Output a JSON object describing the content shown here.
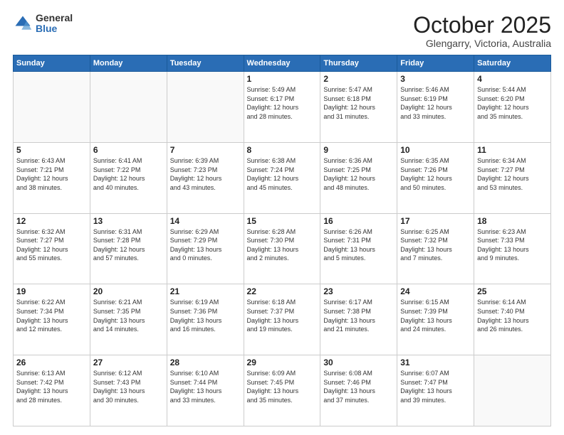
{
  "logo": {
    "general": "General",
    "blue": "Blue"
  },
  "title": "October 2025",
  "location": "Glengarry, Victoria, Australia",
  "days_header": [
    "Sunday",
    "Monday",
    "Tuesday",
    "Wednesday",
    "Thursday",
    "Friday",
    "Saturday"
  ],
  "weeks": [
    [
      {
        "day": "",
        "info": ""
      },
      {
        "day": "",
        "info": ""
      },
      {
        "day": "",
        "info": ""
      },
      {
        "day": "1",
        "info": "Sunrise: 5:49 AM\nSunset: 6:17 PM\nDaylight: 12 hours\nand 28 minutes."
      },
      {
        "day": "2",
        "info": "Sunrise: 5:47 AM\nSunset: 6:18 PM\nDaylight: 12 hours\nand 31 minutes."
      },
      {
        "day": "3",
        "info": "Sunrise: 5:46 AM\nSunset: 6:19 PM\nDaylight: 12 hours\nand 33 minutes."
      },
      {
        "day": "4",
        "info": "Sunrise: 5:44 AM\nSunset: 6:20 PM\nDaylight: 12 hours\nand 35 minutes."
      }
    ],
    [
      {
        "day": "5",
        "info": "Sunrise: 6:43 AM\nSunset: 7:21 PM\nDaylight: 12 hours\nand 38 minutes."
      },
      {
        "day": "6",
        "info": "Sunrise: 6:41 AM\nSunset: 7:22 PM\nDaylight: 12 hours\nand 40 minutes."
      },
      {
        "day": "7",
        "info": "Sunrise: 6:39 AM\nSunset: 7:23 PM\nDaylight: 12 hours\nand 43 minutes."
      },
      {
        "day": "8",
        "info": "Sunrise: 6:38 AM\nSunset: 7:24 PM\nDaylight: 12 hours\nand 45 minutes."
      },
      {
        "day": "9",
        "info": "Sunrise: 6:36 AM\nSunset: 7:25 PM\nDaylight: 12 hours\nand 48 minutes."
      },
      {
        "day": "10",
        "info": "Sunrise: 6:35 AM\nSunset: 7:26 PM\nDaylight: 12 hours\nand 50 minutes."
      },
      {
        "day": "11",
        "info": "Sunrise: 6:34 AM\nSunset: 7:27 PM\nDaylight: 12 hours\nand 53 minutes."
      }
    ],
    [
      {
        "day": "12",
        "info": "Sunrise: 6:32 AM\nSunset: 7:27 PM\nDaylight: 12 hours\nand 55 minutes."
      },
      {
        "day": "13",
        "info": "Sunrise: 6:31 AM\nSunset: 7:28 PM\nDaylight: 12 hours\nand 57 minutes."
      },
      {
        "day": "14",
        "info": "Sunrise: 6:29 AM\nSunset: 7:29 PM\nDaylight: 13 hours\nand 0 minutes."
      },
      {
        "day": "15",
        "info": "Sunrise: 6:28 AM\nSunset: 7:30 PM\nDaylight: 13 hours\nand 2 minutes."
      },
      {
        "day": "16",
        "info": "Sunrise: 6:26 AM\nSunset: 7:31 PM\nDaylight: 13 hours\nand 5 minutes."
      },
      {
        "day": "17",
        "info": "Sunrise: 6:25 AM\nSunset: 7:32 PM\nDaylight: 13 hours\nand 7 minutes."
      },
      {
        "day": "18",
        "info": "Sunrise: 6:23 AM\nSunset: 7:33 PM\nDaylight: 13 hours\nand 9 minutes."
      }
    ],
    [
      {
        "day": "19",
        "info": "Sunrise: 6:22 AM\nSunset: 7:34 PM\nDaylight: 13 hours\nand 12 minutes."
      },
      {
        "day": "20",
        "info": "Sunrise: 6:21 AM\nSunset: 7:35 PM\nDaylight: 13 hours\nand 14 minutes."
      },
      {
        "day": "21",
        "info": "Sunrise: 6:19 AM\nSunset: 7:36 PM\nDaylight: 13 hours\nand 16 minutes."
      },
      {
        "day": "22",
        "info": "Sunrise: 6:18 AM\nSunset: 7:37 PM\nDaylight: 13 hours\nand 19 minutes."
      },
      {
        "day": "23",
        "info": "Sunrise: 6:17 AM\nSunset: 7:38 PM\nDaylight: 13 hours\nand 21 minutes."
      },
      {
        "day": "24",
        "info": "Sunrise: 6:15 AM\nSunset: 7:39 PM\nDaylight: 13 hours\nand 24 minutes."
      },
      {
        "day": "25",
        "info": "Sunrise: 6:14 AM\nSunset: 7:40 PM\nDaylight: 13 hours\nand 26 minutes."
      }
    ],
    [
      {
        "day": "26",
        "info": "Sunrise: 6:13 AM\nSunset: 7:42 PM\nDaylight: 13 hours\nand 28 minutes."
      },
      {
        "day": "27",
        "info": "Sunrise: 6:12 AM\nSunset: 7:43 PM\nDaylight: 13 hours\nand 30 minutes."
      },
      {
        "day": "28",
        "info": "Sunrise: 6:10 AM\nSunset: 7:44 PM\nDaylight: 13 hours\nand 33 minutes."
      },
      {
        "day": "29",
        "info": "Sunrise: 6:09 AM\nSunset: 7:45 PM\nDaylight: 13 hours\nand 35 minutes."
      },
      {
        "day": "30",
        "info": "Sunrise: 6:08 AM\nSunset: 7:46 PM\nDaylight: 13 hours\nand 37 minutes."
      },
      {
        "day": "31",
        "info": "Sunrise: 6:07 AM\nSunset: 7:47 PM\nDaylight: 13 hours\nand 39 minutes."
      },
      {
        "day": "",
        "info": ""
      }
    ]
  ]
}
